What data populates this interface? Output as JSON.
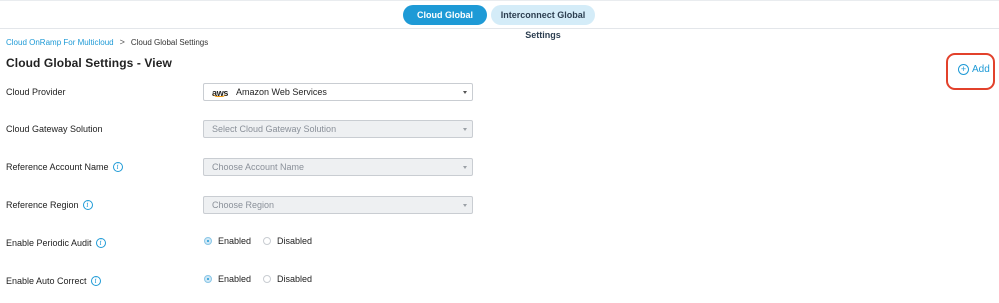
{
  "tabs": [
    {
      "label": "Cloud Global Settings",
      "active": true
    },
    {
      "label": "Interconnect Global Settings",
      "active": false
    }
  ],
  "breadcrumb": {
    "parent": "Cloud OnRamp For Multicloud",
    "separator": ">",
    "current": "Cloud Global Settings"
  },
  "page_title": "Cloud Global Settings - View",
  "add_button": {
    "label": "Add",
    "icon": "plus-circle-icon"
  },
  "form": {
    "cloud_provider": {
      "label": "Cloud Provider",
      "value": "Amazon Web Services",
      "logo_text": "aws"
    },
    "gateway_solution": {
      "label": "Cloud Gateway Solution",
      "placeholder": "Select Cloud Gateway Solution"
    },
    "reference_account": {
      "label": "Reference Account Name",
      "placeholder": "Choose Account Name"
    },
    "reference_region": {
      "label": "Reference Region",
      "placeholder": "Choose Region"
    },
    "periodic_audit": {
      "label": "Enable Periodic Audit",
      "options": [
        "Enabled",
        "Disabled"
      ],
      "selected": "Enabled"
    },
    "auto_correct": {
      "label": "Enable Auto Correct",
      "options": [
        "Enabled",
        "Disabled"
      ],
      "selected": "Enabled"
    }
  },
  "colors": {
    "accent": "#1e9ad6",
    "highlight": "#e2412b",
    "tab_inactive_bg": "#d4ecf8",
    "aws_orange": "#f39c12"
  }
}
